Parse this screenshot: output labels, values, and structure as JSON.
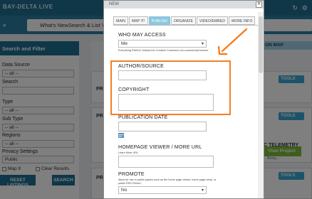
{
  "header": {
    "brand": "BAY-DELTA LIVE",
    "nav": {
      "whats_new": "What's New",
      "search_list": "Search & List Vie"
    }
  },
  "left_panel": {
    "title": "Search and Filter",
    "data_source_label": "Data Source",
    "data_source_value": "-- all --",
    "search_label": "Search",
    "type_label": "Type",
    "type_value": "-- all --",
    "subtype_label": "Sub Type",
    "subtype_value": "-- all --",
    "regions_label": "Regions",
    "regions_value": "-- all --",
    "privacy_label": "Privacy Settings",
    "privacy_value": "Public",
    "map_it": "Map It",
    "clear_results": "Clear Results",
    "reset_button": "RESET LISTINGS",
    "search_button": "SEARCH"
  },
  "main": {
    "map_tab": "ON MAP",
    "card1_title_left": "PRO",
    "card1_tools": "TOOLS",
    "card2_title_left": "PRO",
    "card2_title_right": "C TELEMETRY",
    "card2_tools": "TOOLS",
    "card2_subtext": "Army...",
    "view_project": "View Project",
    "card3_title_left": "PRO",
    "card3_tools": "TOOLS"
  },
  "modal": {
    "title": "NEW",
    "tabs": [
      {
        "label": "MAIN",
        "active": false
      },
      {
        "label": "MAP IT!",
        "active": false
      },
      {
        "label": "PUBLISH",
        "active": true
      },
      {
        "label": "ORGANIZE",
        "active": false
      },
      {
        "label": "VIDEO/EMBED",
        "active": false
      },
      {
        "label": "MORE INFO",
        "active": false
      }
    ],
    "who_may_access_label": "WHO MAY ACCESS",
    "who_may_access_value": "Me",
    "who_may_access_hint": "Everything PUBLIC follows the Creative Commons non-commercial license.",
    "author_label": "AUTHOR/SOURCE",
    "author_value": "",
    "copyright_label": "COPYRIGHT",
    "copyright_value": "",
    "publication_date_label": "PUBLICATION DATE",
    "homepage_label": "HOMEPAGE VIEWER / MORE URL",
    "homepage_hint": "Learn More URL",
    "promote_label": "PROMOTE",
    "promote_hint": "Allow for use in public places such as the home page viewer, home page news, or public RSS Feeds?",
    "promote_value": "No"
  },
  "colors": {
    "highlight": "#f47f24",
    "active_tab": "#8cc7df",
    "brand_blue": "#1c6e92"
  }
}
